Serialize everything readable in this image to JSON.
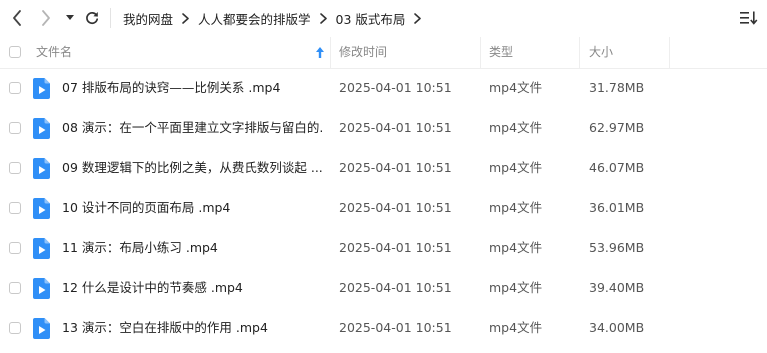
{
  "toolbar": {
    "back_icon": "chevron-left-icon",
    "forward_icon": "chevron-right-icon",
    "history_icon": "caret-down-icon",
    "refresh_icon": "refresh-icon",
    "view_icon": "list-view-sort-icon"
  },
  "breadcrumb": [
    {
      "label": "我的网盘"
    },
    {
      "label": "人人都要会的排版学"
    },
    {
      "label": "03 版式布局"
    }
  ],
  "columns": {
    "name": "文件名",
    "modified": "修改时间",
    "type": "类型",
    "size": "大小",
    "sort_icon": "sort-ascending-icon"
  },
  "files": [
    {
      "name": "07 排版布局的诀窍——比例关系 .mp4",
      "modified": "2025-04-01 10:51",
      "type": "mp4文件",
      "size": "31.78MB",
      "icon": "video-file-icon"
    },
    {
      "name": "08 演示：在一个平面里建立文字排版与留白的...",
      "modified": "2025-04-01 10:51",
      "type": "mp4文件",
      "size": "62.97MB",
      "icon": "video-file-icon"
    },
    {
      "name": "09 数理逻辑下的比例之美，从费氏数列谈起 ....",
      "modified": "2025-04-01 10:51",
      "type": "mp4文件",
      "size": "46.07MB",
      "icon": "video-file-icon"
    },
    {
      "name": "10 设计不同的页面布局 .mp4",
      "modified": "2025-04-01 10:51",
      "type": "mp4文件",
      "size": "36.01MB",
      "icon": "video-file-icon"
    },
    {
      "name": "11 演示：布局小练习 .mp4",
      "modified": "2025-04-01 10:51",
      "type": "mp4文件",
      "size": "53.96MB",
      "icon": "video-file-icon"
    },
    {
      "name": "12 什么是设计中的节奏感 .mp4",
      "modified": "2025-04-01 10:51",
      "type": "mp4文件",
      "size": "39.40MB",
      "icon": "video-file-icon"
    },
    {
      "name": "13 演示：空白在排版中的作用 .mp4",
      "modified": "2025-04-01 10:51",
      "type": "mp4文件",
      "size": "34.00MB",
      "icon": "video-file-icon"
    }
  ],
  "colors": {
    "accent": "#2f8ff7",
    "text": "#222222",
    "muted": "#888888",
    "border": "#eeeeee"
  }
}
